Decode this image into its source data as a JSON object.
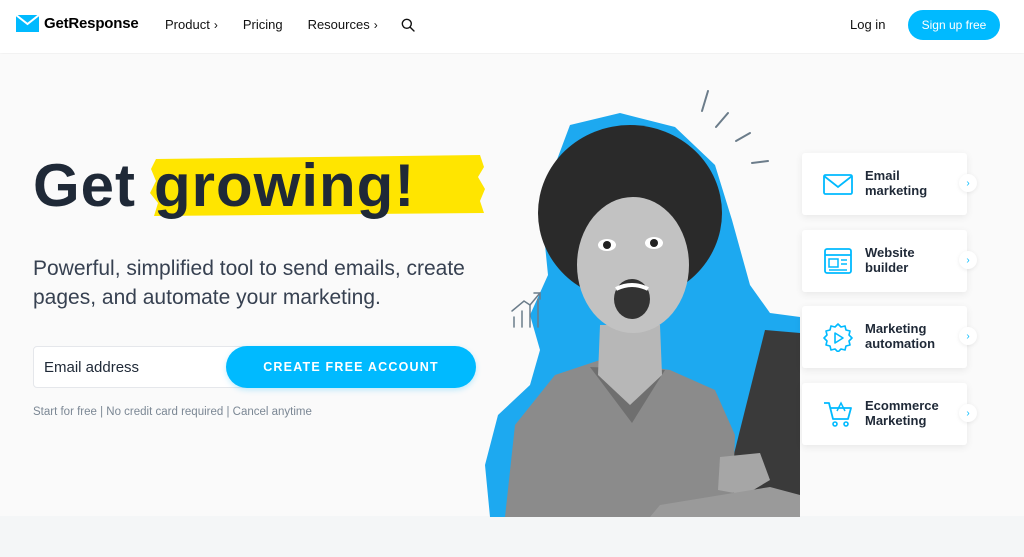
{
  "brand": {
    "name": "GetResponse",
    "accent": "#00baff",
    "highlight": "#ffe500"
  },
  "nav": {
    "items": [
      {
        "label": "Product",
        "chevron": "›"
      },
      {
        "label": "Pricing",
        "chevron": ""
      },
      {
        "label": "Resources",
        "chevron": "›"
      }
    ],
    "search_icon": "search-icon",
    "login_label": "Log in",
    "signup_label": "Sign up free"
  },
  "hero": {
    "title_plain": "Get",
    "title_highlight": "growing!",
    "subtitle": "Powerful, simplified tool to send emails, create pages, and automate your marketing.",
    "email_placeholder": "Email address",
    "cta_label": "CREATE FREE ACCOUNT",
    "fine_print": "Start for free | No credit card required | Cancel anytime"
  },
  "features": [
    {
      "label": "Email marketing",
      "icon": "envelope-icon"
    },
    {
      "label": "Website builder",
      "icon": "website-icon"
    },
    {
      "label": "Marketing automation",
      "icon": "automation-gear-icon"
    },
    {
      "label": "Ecommerce Marketing",
      "icon": "shopping-cart-icon"
    }
  ]
}
